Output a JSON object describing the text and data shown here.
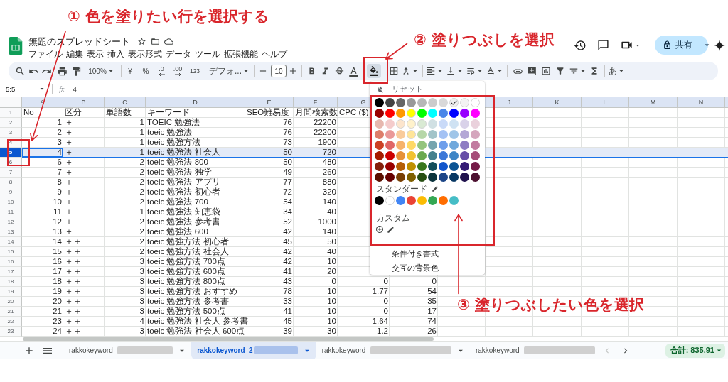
{
  "annotations": [
    {
      "text": "① 色を塗りたい行を選択する"
    },
    {
      "text": "② 塗りつぶしを選択"
    },
    {
      "text": "③ 塗りつぶしたい色を選択"
    }
  ],
  "doc": {
    "title": "無題のスプレッドシート",
    "menu": [
      "ファイル",
      "編集",
      "表示",
      "挿入",
      "表示形式",
      "データ",
      "ツール",
      "拡張機能",
      "ヘルプ"
    ],
    "share": "共有"
  },
  "toolbar": {
    "zoom": "100%",
    "currency": "¥",
    "percent": "%",
    "decimal_decrease": ".0",
    "decimal_increase": ".00",
    "number_format": "123",
    "font": "デフォ...",
    "font_size": "10",
    "input_tools": "あ",
    "fill_open": true
  },
  "formula_bar": {
    "cell": "5:5",
    "fx": "fx",
    "value": "4"
  },
  "columns": {
    "left": [
      "A",
      "B",
      "C",
      "D",
      "E",
      "F",
      "G"
    ],
    "right": [
      "J",
      "K",
      "L",
      "M",
      "N"
    ]
  },
  "rows": [
    {
      "kind": "header",
      "number": "1",
      "selected": false,
      "cells": [
        "No",
        "区分",
        "単語数",
        "キーワード",
        "SEO難易度",
        "月間検索数",
        "CPC ($)"
      ]
    },
    {
      "kind": "data",
      "number": "2",
      "selected": false,
      "cells": [
        "1",
        "＋",
        "1",
        "TOEIC 勉強法",
        "76",
        "22200"
      ]
    },
    {
      "kind": "data",
      "number": "3",
      "selected": false,
      "cells": [
        "2",
        "＋",
        "1",
        "toeic 勉強法",
        "76",
        "22200"
      ]
    },
    {
      "kind": "data",
      "number": "4",
      "selected": false,
      "cells": [
        "3",
        "＋",
        "1",
        "toeic 勉強方法",
        "73",
        "1900"
      ]
    },
    {
      "kind": "data",
      "number": "5",
      "selected": true,
      "cells": [
        "4",
        "＋",
        "1",
        "toeic 勉強法 社会人",
        "50",
        "720"
      ]
    },
    {
      "kind": "data",
      "number": "6",
      "selected": false,
      "cells": [
        "6",
        "＋",
        "2",
        "toeic 勉強法 800",
        "50",
        "480"
      ]
    },
    {
      "kind": "data",
      "number": "7",
      "selected": false,
      "cells": [
        "7",
        "＋",
        "2",
        "toeic 勉強法 独学",
        "49",
        "260"
      ]
    },
    {
      "kind": "data",
      "number": "8",
      "selected": false,
      "cells": [
        "8",
        "＋",
        "2",
        "toeic 勉強法 アプリ",
        "77",
        "880"
      ]
    },
    {
      "kind": "data",
      "number": "9",
      "selected": false,
      "cells": [
        "9",
        "＋",
        "2",
        "toeic 勉強法 初心者",
        "72",
        "320"
      ]
    },
    {
      "kind": "data",
      "number": "10",
      "selected": false,
      "cells": [
        "10",
        "＋",
        "2",
        "toeic 勉強法 700",
        "54",
        "140"
      ]
    },
    {
      "kind": "data",
      "number": "11",
      "selected": false,
      "cells": [
        "11",
        "＋",
        "1",
        "toeic 勉強法 知恵袋",
        "34",
        "40"
      ]
    },
    {
      "kind": "data",
      "number": "12",
      "selected": false,
      "cells": [
        "12",
        "＋",
        "2",
        "toeic 勉強法 参考書",
        "52",
        "1000"
      ]
    },
    {
      "kind": "data",
      "number": "13",
      "selected": false,
      "cells": [
        "13",
        "＋",
        "2",
        "toeic 勉強法 600",
        "42",
        "140"
      ]
    },
    {
      "kind": "data",
      "number": "14",
      "selected": false,
      "cells": [
        "14",
        "＋＋",
        "2",
        "toeic 勉強方法 初心者",
        "45",
        "50"
      ]
    },
    {
      "kind": "data",
      "number": "15",
      "selected": false,
      "cells": [
        "15",
        "＋＋",
        "2",
        "toeic 勉強方法 社会人",
        "42",
        "40"
      ]
    },
    {
      "kind": "data",
      "number": "16",
      "selected": false,
      "cells": [
        "16",
        "＋＋",
        "3",
        "toeic 勉強方法 700点",
        "42",
        "10"
      ]
    },
    {
      "kind": "data",
      "number": "17",
      "selected": false,
      "cells": [
        "17",
        "＋＋",
        "3",
        "toeic 勉強方法 600点",
        "41",
        "20"
      ]
    },
    {
      "kind": "data",
      "number": "18",
      "selected": false,
      "cells": [
        "18",
        "＋＋",
        "3",
        "toeic 勉強方法 800点",
        "43",
        "0",
        "0",
        "0"
      ]
    },
    {
      "kind": "data",
      "number": "19",
      "selected": false,
      "cells": [
        "19",
        "＋＋",
        "3",
        "toeic 勉強方法 おすすめ",
        "78",
        "10",
        "1.77",
        "54"
      ]
    },
    {
      "kind": "data",
      "number": "20",
      "selected": false,
      "cells": [
        "20",
        "＋＋",
        "3",
        "toeic 勉強方法 参考書",
        "33",
        "10",
        "0",
        "35"
      ]
    },
    {
      "kind": "data",
      "number": "21",
      "selected": false,
      "cells": [
        "21",
        "＋＋",
        "3",
        "toeic 勉強方法 500点",
        "41",
        "10",
        "0",
        "17"
      ]
    },
    {
      "kind": "data",
      "number": "22",
      "selected": false,
      "cells": [
        "23",
        "＋＋",
        "4",
        "toeic 勉強法 社会人 参考書",
        "45",
        "10",
        "1.64",
        "74"
      ]
    },
    {
      "kind": "data",
      "number": "23",
      "selected": false,
      "cells": [
        "24",
        "＋＋",
        "3",
        "toeic 勉強法 社会人 600点",
        "39",
        "30",
        "1.2",
        "26"
      ]
    }
  ],
  "fill_menu": {
    "reset": "リセット",
    "palette": [
      [
        {
          "color": "#000000",
          "selected": false
        },
        {
          "color": "#434343",
          "selected": false
        },
        {
          "color": "#666666",
          "selected": false
        },
        {
          "color": "#999999",
          "selected": false
        },
        {
          "color": "#b7b7b7",
          "selected": false
        },
        {
          "color": "#cccccc",
          "selected": false
        },
        {
          "color": "#d9d9d9",
          "selected": false
        },
        {
          "color": "#efefef",
          "selected": true
        },
        {
          "color": "#f3f3f3",
          "selected": false
        },
        {
          "color": "#ffffff",
          "selected": false
        }
      ],
      [
        {
          "color": "#980000",
          "selected": false
        },
        {
          "color": "#ff0000",
          "selected": false
        },
        {
          "color": "#ff9900",
          "selected": false
        },
        {
          "color": "#ffff00",
          "selected": false
        },
        {
          "color": "#00ff00",
          "selected": false
        },
        {
          "color": "#00ffff",
          "selected": false
        },
        {
          "color": "#4a86e8",
          "selected": false
        },
        {
          "color": "#0000ff",
          "selected": false
        },
        {
          "color": "#9900ff",
          "selected": false
        },
        {
          "color": "#ff00ff",
          "selected": false
        }
      ],
      [
        {
          "color": "#e6b8af",
          "selected": false
        },
        {
          "color": "#f4cccc",
          "selected": false
        },
        {
          "color": "#fce5cd",
          "selected": false
        },
        {
          "color": "#fff2cc",
          "selected": false
        },
        {
          "color": "#d9ead3",
          "selected": false
        },
        {
          "color": "#d0e0e3",
          "selected": false
        },
        {
          "color": "#c9daf8",
          "selected": false
        },
        {
          "color": "#cfe2f3",
          "selected": false
        },
        {
          "color": "#d9d2e9",
          "selected": false
        },
        {
          "color": "#ead1dc",
          "selected": false
        }
      ],
      [
        {
          "color": "#dd7e6b",
          "selected": false
        },
        {
          "color": "#ea9999",
          "selected": false
        },
        {
          "color": "#f9cb9c",
          "selected": false
        },
        {
          "color": "#ffe599",
          "selected": false
        },
        {
          "color": "#b6d7a8",
          "selected": false
        },
        {
          "color": "#a2c4c9",
          "selected": false
        },
        {
          "color": "#a4c2f4",
          "selected": false
        },
        {
          "color": "#9fc5e8",
          "selected": false
        },
        {
          "color": "#b4a7d6",
          "selected": false
        },
        {
          "color": "#d5a6bd",
          "selected": false
        }
      ],
      [
        {
          "color": "#cc4125",
          "selected": false
        },
        {
          "color": "#e06666",
          "selected": false
        },
        {
          "color": "#f6b26b",
          "selected": false
        },
        {
          "color": "#ffd966",
          "selected": false
        },
        {
          "color": "#93c47d",
          "selected": false
        },
        {
          "color": "#76a5af",
          "selected": false
        },
        {
          "color": "#6d9eeb",
          "selected": false
        },
        {
          "color": "#6fa8dc",
          "selected": false
        },
        {
          "color": "#8e7cc3",
          "selected": false
        },
        {
          "color": "#c27ba0",
          "selected": false
        }
      ],
      [
        {
          "color": "#a61c00",
          "selected": false
        },
        {
          "color": "#cc0000",
          "selected": false
        },
        {
          "color": "#e69138",
          "selected": false
        },
        {
          "color": "#f1c232",
          "selected": false
        },
        {
          "color": "#6aa84f",
          "selected": false
        },
        {
          "color": "#45818e",
          "selected": false
        },
        {
          "color": "#3c78d8",
          "selected": false
        },
        {
          "color": "#3d85c6",
          "selected": false
        },
        {
          "color": "#674ea7",
          "selected": false
        },
        {
          "color": "#a64d79",
          "selected": false
        }
      ],
      [
        {
          "color": "#85200c",
          "selected": false
        },
        {
          "color": "#990000",
          "selected": false
        },
        {
          "color": "#b45f06",
          "selected": false
        },
        {
          "color": "#bf9000",
          "selected": false
        },
        {
          "color": "#38761d",
          "selected": false
        },
        {
          "color": "#134f5c",
          "selected": false
        },
        {
          "color": "#1155cc",
          "selected": false
        },
        {
          "color": "#0b5394",
          "selected": false
        },
        {
          "color": "#351c75",
          "selected": false
        },
        {
          "color": "#741b47",
          "selected": false
        }
      ],
      [
        {
          "color": "#5b0f00",
          "selected": false
        },
        {
          "color": "#660000",
          "selected": false
        },
        {
          "color": "#783f04",
          "selected": false
        },
        {
          "color": "#7f6000",
          "selected": false
        },
        {
          "color": "#274e13",
          "selected": false
        },
        {
          "color": "#0c343d",
          "selected": false
        },
        {
          "color": "#1c4587",
          "selected": false
        },
        {
          "color": "#073763",
          "selected": false
        },
        {
          "color": "#20124d",
          "selected": false
        },
        {
          "color": "#4c1130",
          "selected": false
        }
      ]
    ],
    "standard_label": "スタンダード",
    "standard": [
      {
        "color": "#000000",
        "selected": false
      },
      {
        "color": "#ffffff",
        "selected": false
      },
      {
        "color": "#4285f4",
        "selected": false
      },
      {
        "color": "#ea4335",
        "selected": false
      },
      {
        "color": "#fbbc04",
        "selected": false
      },
      {
        "color": "#34a853",
        "selected": false
      },
      {
        "color": "#ff6d01",
        "selected": false
      },
      {
        "color": "#46bdc6",
        "selected": false
      }
    ],
    "custom_label": "カスタム",
    "items": [
      "条件付き書式",
      "交互の背景色"
    ]
  },
  "sheet_tabs": [
    {
      "label": "rakkokeyword_",
      "selected": false,
      "caret": true
    },
    {
      "label": "rakkokeyword_2",
      "selected": true,
      "caret": true
    },
    {
      "label": "rakkokeyword_",
      "selected": false,
      "caret": true
    },
    {
      "label": "rakkokeyword_",
      "selected": false,
      "caret": false
    }
  ],
  "tab_scroll": [
    {
      "kind": "left",
      "disabled": true
    },
    {
      "kind": "right",
      "disabled": false
    }
  ],
  "sum": "合計: 835.91"
}
